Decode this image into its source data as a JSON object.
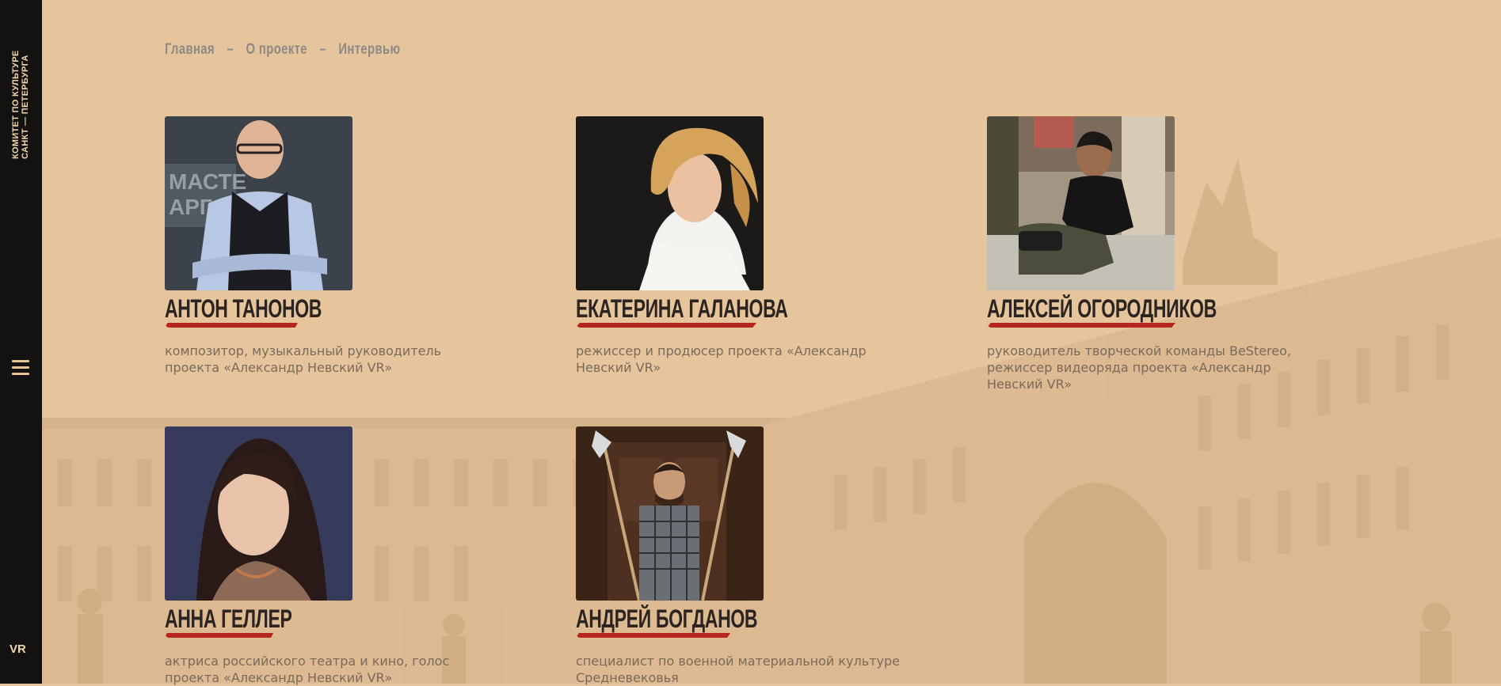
{
  "sidebar": {
    "org_line1": "Комитет по культуре",
    "org_line2": "Санкт — Петербурга",
    "menu_icon": "hamburger-icon",
    "vr_label": "VR"
  },
  "breadcrumb": {
    "items": [
      "Главная",
      "О проекте",
      "Интервью"
    ],
    "separator": "–"
  },
  "people": [
    {
      "name": "Антон Танонов",
      "role": "композитор, музыкальный руководитель проекта «Александр Невский VR»"
    },
    {
      "name": "Екатерина Галанова",
      "role": "режиссер и продюсер проекта «Александр Невский VR»"
    },
    {
      "name": "Алексей Огородников",
      "role": "руководитель творческой команды BeStereo, режиссер видеоряда проекта «Александр Невский VR»"
    },
    {
      "name": "Анна Геллер",
      "role": "актриса российского театра и кино, голос проекта «Александр Невский VR»"
    },
    {
      "name": "Андрей Богданов",
      "role": "специалист по военной материальной культуре Средневековья"
    }
  ],
  "colors": {
    "background": "#e7c59c",
    "sidebar": "#141210",
    "accent_red": "#b5261e",
    "name_text": "#2b2420",
    "role_text": "#7a6a5b"
  }
}
